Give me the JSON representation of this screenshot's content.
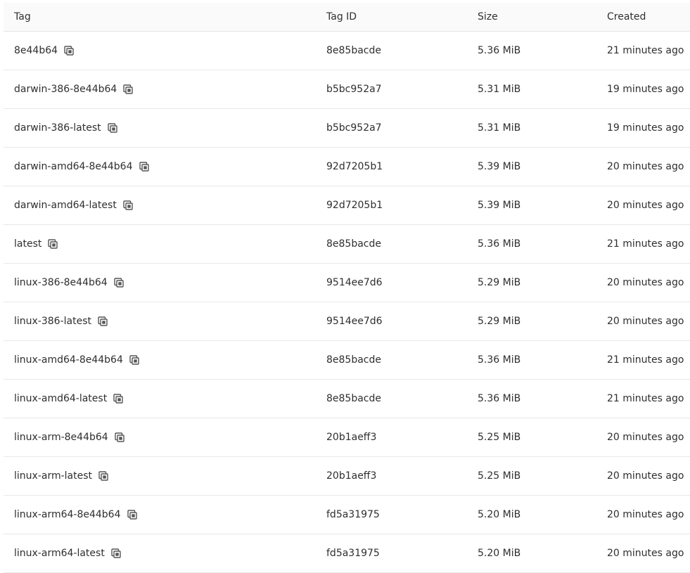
{
  "table": {
    "headers": {
      "tag": "Tag",
      "tag_id": "Tag ID",
      "size": "Size",
      "created": "Created"
    },
    "rows": [
      {
        "tag": "8e44b64",
        "tag_id": "8e85bacde",
        "size": "5.36 MiB",
        "created": "21 minutes ago"
      },
      {
        "tag": "darwin-386-8e44b64",
        "tag_id": "b5bc952a7",
        "size": "5.31 MiB",
        "created": "19 minutes ago"
      },
      {
        "tag": "darwin-386-latest",
        "tag_id": "b5bc952a7",
        "size": "5.31 MiB",
        "created": "19 minutes ago"
      },
      {
        "tag": "darwin-amd64-8e44b64",
        "tag_id": "92d7205b1",
        "size": "5.39 MiB",
        "created": "20 minutes ago"
      },
      {
        "tag": "darwin-amd64-latest",
        "tag_id": "92d7205b1",
        "size": "5.39 MiB",
        "created": "20 minutes ago"
      },
      {
        "tag": "latest",
        "tag_id": "8e85bacde",
        "size": "5.36 MiB",
        "created": "21 minutes ago"
      },
      {
        "tag": "linux-386-8e44b64",
        "tag_id": "9514ee7d6",
        "size": "5.29 MiB",
        "created": "20 minutes ago"
      },
      {
        "tag": "linux-386-latest",
        "tag_id": "9514ee7d6",
        "size": "5.29 MiB",
        "created": "20 minutes ago"
      },
      {
        "tag": "linux-amd64-8e44b64",
        "tag_id": "8e85bacde",
        "size": "5.36 MiB",
        "created": "21 minutes ago"
      },
      {
        "tag": "linux-amd64-latest",
        "tag_id": "8e85bacde",
        "size": "5.36 MiB",
        "created": "21 minutes ago"
      },
      {
        "tag": "linux-arm-8e44b64",
        "tag_id": "20b1aeff3",
        "size": "5.25 MiB",
        "created": "20 minutes ago"
      },
      {
        "tag": "linux-arm-latest",
        "tag_id": "20b1aeff3",
        "size": "5.25 MiB",
        "created": "20 minutes ago"
      },
      {
        "tag": "linux-arm64-8e44b64",
        "tag_id": "fd5a31975",
        "size": "5.20 MiB",
        "created": "20 minutes ago"
      },
      {
        "tag": "linux-arm64-latest",
        "tag_id": "fd5a31975",
        "size": "5.20 MiB",
        "created": "20 minutes ago"
      }
    ]
  },
  "icons": {
    "copy": "copy-icon"
  }
}
